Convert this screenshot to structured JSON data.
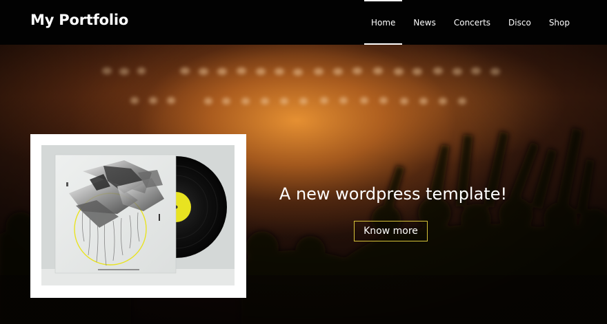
{
  "header": {
    "logo": "My Portfolio",
    "nav": [
      {
        "label": "Home",
        "active": true
      },
      {
        "label": "News",
        "active": false
      },
      {
        "label": "Concerts",
        "active": false
      },
      {
        "label": "Disco",
        "active": false
      },
      {
        "label": "Shop",
        "active": false
      }
    ]
  },
  "hero": {
    "title": "A new wordpress template!",
    "cta_label": "Know more",
    "image": "vinyl-record-album-cover",
    "background": "concert-crowd-stage-lights"
  },
  "colors": {
    "header_bg": "#020202",
    "text": "#ffffff",
    "button_border": "#d8c43a",
    "stage_glow": "#ee9634",
    "record_label": "#e8e321"
  }
}
